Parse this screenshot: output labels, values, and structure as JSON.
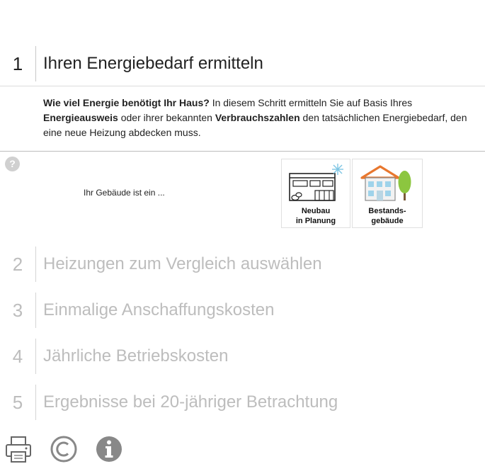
{
  "steps": [
    {
      "number": "1",
      "title": "Ihren Energiebedarf ermitteln"
    },
    {
      "number": "2",
      "title": "Heizungen zum Vergleich auswählen"
    },
    {
      "number": "3",
      "title": "Einmalige Anschaffungskosten"
    },
    {
      "number": "4",
      "title": "Jährliche Betriebskosten"
    },
    {
      "number": "5",
      "title": "Ergebnisse bei 20-jähriger Betrachtung"
    }
  ],
  "description": {
    "bold1": "Wie viel Energie benötigt Ihr Haus?",
    "text1": " In diesem Schritt ermitteln Sie auf Basis Ihres",
    "bold2": "Energieausweis",
    "text2": " oder ihrer bekannten ",
    "bold3": "Verbrauchszahlen",
    "text3": " den tatsächlichen Energiebedarf, den",
    "text4": "eine neue Heizung abdecken muss."
  },
  "help": {
    "symbol": "?"
  },
  "building": {
    "label": "Ihr Gebäude ist ein ...",
    "options": [
      {
        "line1": "Neubau",
        "line2": "in Planung",
        "icon": "new-building-icon"
      },
      {
        "line1": "Bestands-",
        "line2": "gebäude",
        "icon": "existing-house-icon"
      }
    ]
  },
  "footer": {
    "icons": [
      "printer-icon",
      "copyright-icon",
      "info-icon"
    ]
  },
  "colors": {
    "active_text": "#222222",
    "inactive_text": "#bdbdbd",
    "roof_orange": "#e8772e",
    "window_blue": "#9fd3ea",
    "tree_green": "#8cc63f",
    "icon_gray": "#888888"
  }
}
